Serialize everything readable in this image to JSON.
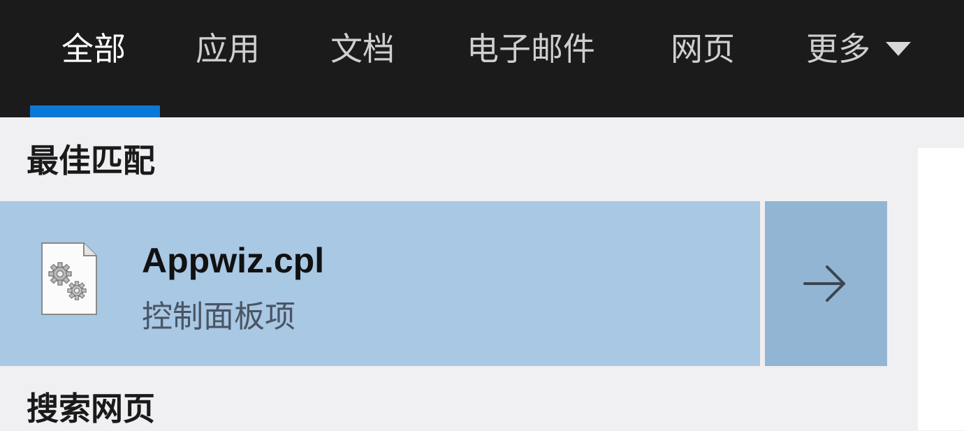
{
  "tabs": [
    {
      "label": "全部",
      "active": true
    },
    {
      "label": "应用",
      "active": false
    },
    {
      "label": "文档",
      "active": false
    },
    {
      "label": "电子邮件",
      "active": false
    },
    {
      "label": "网页",
      "active": false
    },
    {
      "label": "更多",
      "active": false
    }
  ],
  "colors": {
    "tab_bar_bg": "#1b1b1b",
    "accent": "#0a78d7",
    "selected_row": "#a8c8e4",
    "selected_row_arrow": "#92b5d3",
    "panel_bg": "#f0eff1"
  },
  "best_match": {
    "heading": "最佳匹配",
    "result": {
      "title": "Appwiz.cpl",
      "subtitle": "控制面板项",
      "icon": "control-panel-file-icon",
      "open_icon": "arrow-right-icon"
    }
  },
  "web_search": {
    "heading": "搜索网页"
  }
}
